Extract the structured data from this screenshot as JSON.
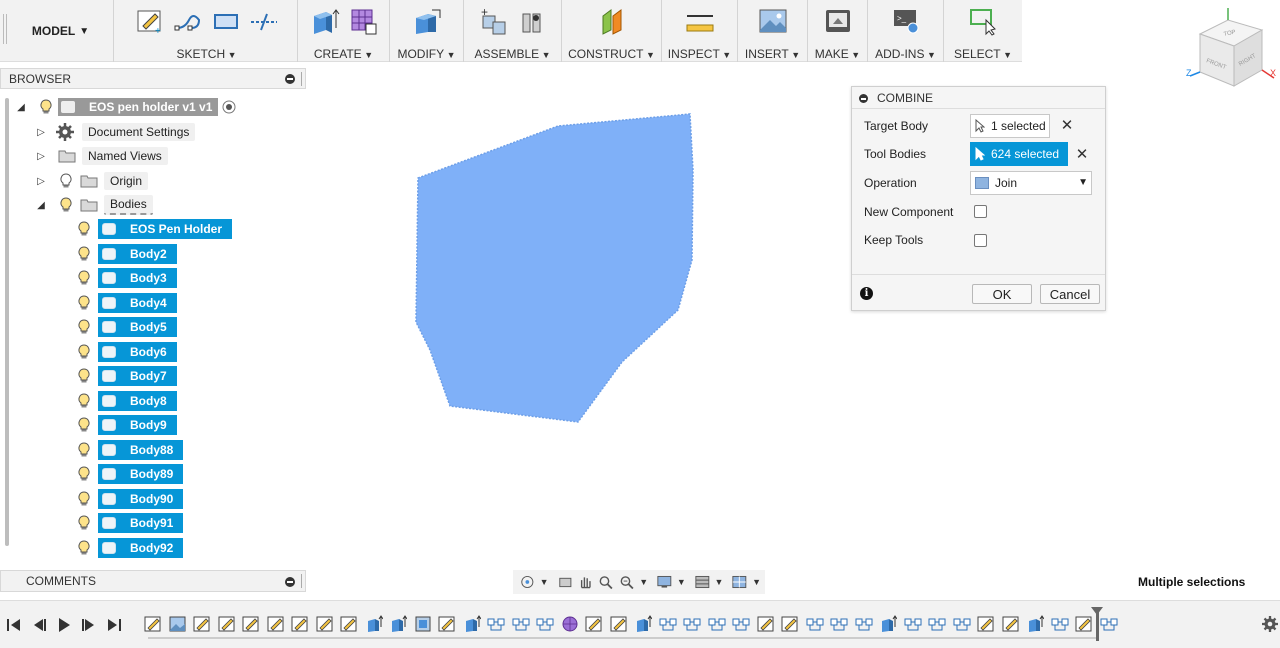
{
  "toolbar": {
    "model_label": "MODEL",
    "groups": [
      {
        "label": "SKETCH"
      },
      {
        "label": "CREATE"
      },
      {
        "label": "MODIFY"
      },
      {
        "label": "ASSEMBLE"
      },
      {
        "label": "CONSTRUCT"
      },
      {
        "label": "INSPECT"
      },
      {
        "label": "INSERT"
      },
      {
        "label": "MAKE"
      },
      {
        "label": "ADD-INS"
      },
      {
        "label": "SELECT"
      }
    ]
  },
  "browser": {
    "title": "BROWSER",
    "root": "EOS pen holder v1 v1",
    "nodes": [
      {
        "label": "Document Settings"
      },
      {
        "label": "Named Views"
      },
      {
        "label": "Origin"
      },
      {
        "label": "Bodies"
      }
    ],
    "bodies": [
      "EOS Pen Holder",
      "Body2",
      "Body3",
      "Body4",
      "Body5",
      "Body6",
      "Body7",
      "Body8",
      "Body9",
      "Body88",
      "Body89",
      "Body90",
      "Body91",
      "Body92"
    ]
  },
  "comments": {
    "title": "COMMENTS"
  },
  "combine": {
    "title": "COMBINE",
    "target_body_label": "Target Body",
    "target_body_value": "1 selected",
    "tool_bodies_label": "Tool Bodies",
    "tool_bodies_value": "624 selected",
    "operation_label": "Operation",
    "operation_value": "Join",
    "new_component_label": "New Component",
    "new_component_checked": false,
    "keep_tools_label": "Keep Tools",
    "keep_tools_checked": false,
    "ok_label": "OK",
    "cancel_label": "Cancel",
    "info_glyph": "i"
  },
  "viewcube": {
    "top": "TOP",
    "front": "FRONT",
    "right": "RIGHT",
    "x": "X",
    "z": "Z"
  },
  "status": {
    "text": "Multiple selections"
  },
  "colors": {
    "selection": "#0696d7",
    "body": "#7fb0f8",
    "toolbar": "#f2f2f2"
  },
  "timeline": {
    "item_count": 40
  }
}
